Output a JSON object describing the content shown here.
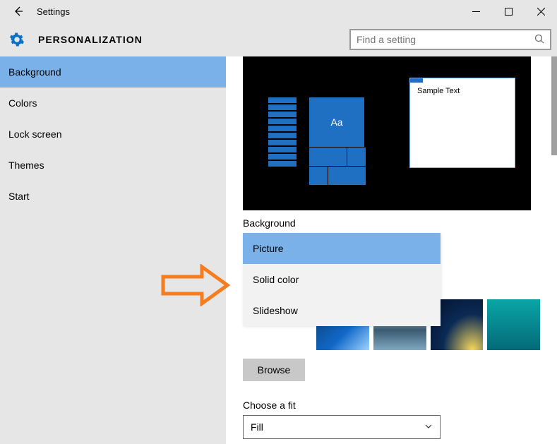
{
  "window": {
    "title": "Settings"
  },
  "header": {
    "heading": "PERSONALIZATION",
    "search_placeholder": "Find a setting"
  },
  "sidebar": {
    "items": [
      {
        "label": "Background",
        "active": true
      },
      {
        "label": "Colors",
        "active": false
      },
      {
        "label": "Lock screen",
        "active": false
      },
      {
        "label": "Themes",
        "active": false
      },
      {
        "label": "Start",
        "active": false
      }
    ]
  },
  "content": {
    "preview": {
      "sample_text": "Sample Text",
      "tile_text": "Aa"
    },
    "background_label": "Background",
    "background_dropdown": {
      "selected": "Picture",
      "options": [
        "Picture",
        "Solid color",
        "Slideshow"
      ]
    },
    "browse_label": "Browse",
    "fit_label": "Choose a fit",
    "fit_selected": "Fill"
  }
}
